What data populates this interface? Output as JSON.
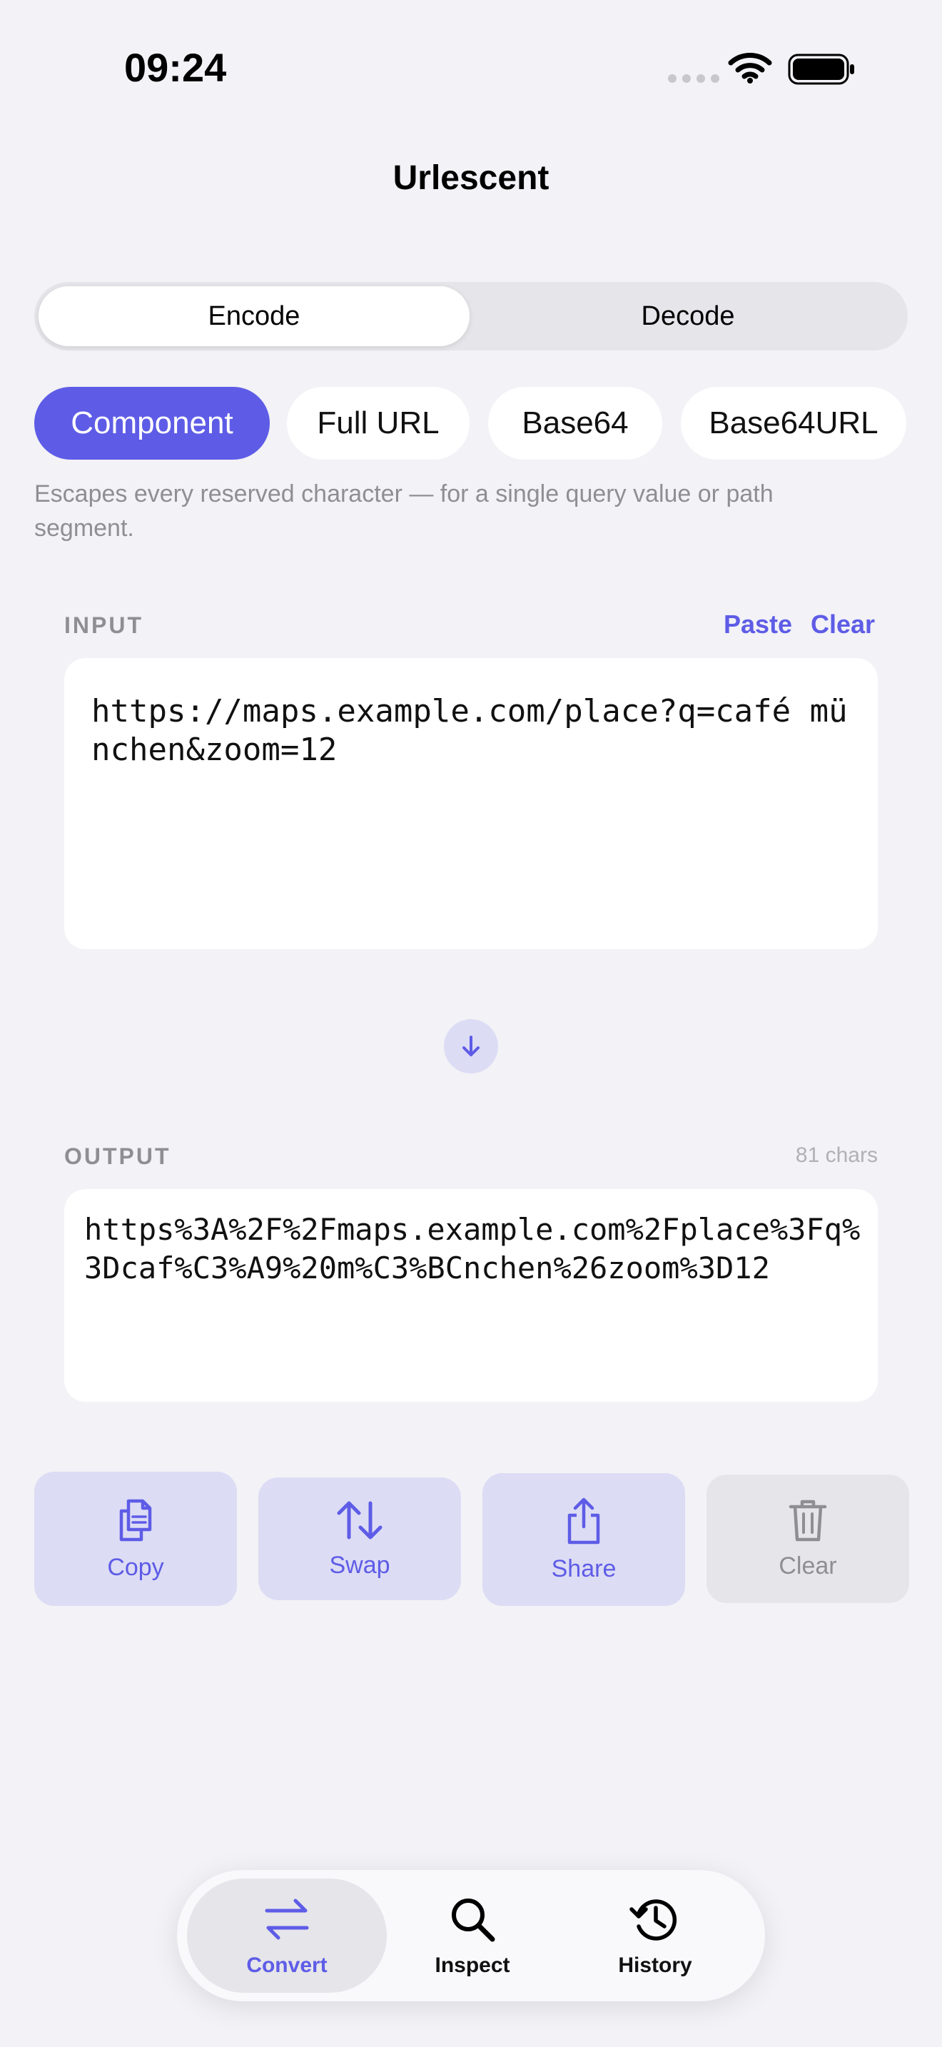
{
  "status": {
    "time": "09:24"
  },
  "app": {
    "title": "Urlescent"
  },
  "direction": {
    "encode": "Encode",
    "decode": "Decode",
    "selected": "Encode"
  },
  "modes": {
    "items": [
      "Component",
      "Full URL",
      "Base64",
      "Base64URL"
    ],
    "selected": "Component",
    "description": "Escapes every reserved character — for a single query value or path segment."
  },
  "input": {
    "label": "INPUT",
    "paste": "Paste",
    "clear": "Clear",
    "value": "https://maps.example.com/place?q=café münchen&zoom=12"
  },
  "output": {
    "label": "OUTPUT",
    "count": "81 chars",
    "value": "https%3A%2F%2Fmaps.example.com%2Fplace%3Fq%3Dcaf%C3%A9%20m%C3%BCnchen%26zoom%3D12"
  },
  "actions": {
    "copy": "Copy",
    "swap": "Swap",
    "share": "Share",
    "clear": "Clear"
  },
  "tabs": {
    "convert": "Convert",
    "inspect": "Inspect",
    "history": "History",
    "selected": "Convert"
  },
  "colors": {
    "accent": "#5e5ce6",
    "background": "#f2f2f7",
    "accent_tint": "#dcdcf5"
  },
  "icons": {
    "copy": "doc-on-doc-icon",
    "swap": "arrow-up-arrow-down-icon",
    "share": "share-icon",
    "clear": "trash-icon",
    "convert": "arrow-left-right-icon",
    "inspect": "magnifier-icon",
    "history": "clock-arrow-icon",
    "flow": "arrow-down-icon"
  }
}
